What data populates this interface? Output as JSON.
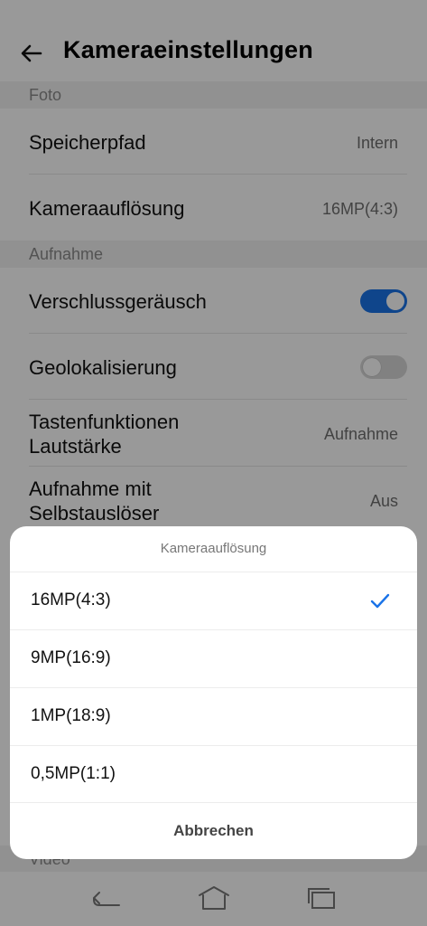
{
  "header": {
    "title": "Kameraeinstellungen"
  },
  "sections": {
    "foto": "Foto",
    "aufnahme": "Aufnahme",
    "video": "Video"
  },
  "rows": {
    "speicherpfad": {
      "label": "Speicherpfad",
      "value": "Intern"
    },
    "kameraaufloesung": {
      "label": "Kameraauflösung",
      "value": "16MP(4:3)"
    },
    "verschlussgeraeusch": {
      "label": "Verschlussgeräusch",
      "enabled": true
    },
    "geolokalisierung": {
      "label": "Geolokalisierung",
      "enabled": false
    },
    "tastenfunktionen": {
      "label_line1": "Tastenfunktionen",
      "label_line2": "Lautstärke",
      "value": "Aufnahme"
    },
    "selbstausloeser": {
      "label_line1": "Aufnahme mit",
      "label_line2": "Selbstauslöser",
      "value": "Aus"
    }
  },
  "dialog": {
    "title": "Kameraauflösung",
    "options": [
      {
        "label": "16MP(4:3)",
        "selected": true
      },
      {
        "label": "9MP(16:9)",
        "selected": false
      },
      {
        "label": "1MP(18:9)",
        "selected": false
      },
      {
        "label": "0,5MP(1:1)",
        "selected": false
      }
    ],
    "cancel_label": "Abbrechen"
  },
  "colors": {
    "accent": "#1a73e8",
    "overlay": "rgba(0,0,0,0.40)"
  },
  "icons": {
    "back": "arrow-left-icon",
    "check": "checkmark-icon",
    "nav_back": "nav-back-icon",
    "nav_home": "nav-home-icon",
    "nav_recents": "nav-recents-icon"
  }
}
